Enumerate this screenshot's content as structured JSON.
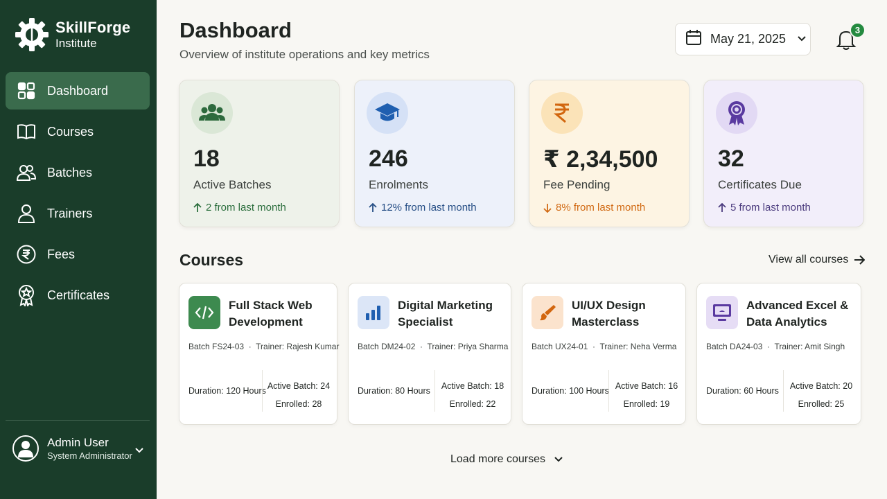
{
  "brand": {
    "name": "SkillForge",
    "subtitle": "Institute"
  },
  "sidebar": {
    "items": [
      {
        "label": "Dashboard",
        "icon": "grid-icon",
        "active": true
      },
      {
        "label": "Courses",
        "icon": "book-icon"
      },
      {
        "label": "Batches",
        "icon": "users-icon"
      },
      {
        "label": "Trainers",
        "icon": "user-icon"
      },
      {
        "label": "Fees",
        "icon": "rupee-icon"
      },
      {
        "label": "Certificates",
        "icon": "award-icon"
      }
    ],
    "user": {
      "name": "Admin User",
      "role": "System Administrator"
    }
  },
  "header": {
    "title": "Dashboard",
    "subtitle": "Overview of institute operations and key metrics",
    "date": "May 21, 2025",
    "notifications": "3"
  },
  "stats": [
    {
      "value": "18",
      "label": "Active Batches",
      "trend": "2 from last month",
      "direction": "up",
      "trend_color": "#2b6e3d",
      "bg": "#eef2ea",
      "icon_bg": "#dae7d6",
      "icon": "users-icon"
    },
    {
      "value": "246",
      "label": "Enrolments",
      "trend": "12% from last month",
      "direction": "up",
      "trend_color": "#274f86",
      "bg": "#edf1fa",
      "icon_bg": "#d5e1f6",
      "icon": "graduation-cap-icon"
    },
    {
      "value": "₹ 2,34,500",
      "label": "Fee Pending",
      "trend": "8% from last month",
      "direction": "down",
      "trend_color": "#d16a14",
      "bg": "#fdf4e3",
      "icon_bg": "#fbe3b8",
      "icon": "rupee-icon"
    },
    {
      "value": "32",
      "label": "Certificates Due",
      "trend": "5 from last month",
      "direction": "up",
      "trend_color": "#4b3b7e",
      "bg": "#f2eefa",
      "icon_bg": "#e2d9f4",
      "icon": "medal-icon"
    }
  ],
  "courses_section": {
    "title": "Courses",
    "view_all": "View all courses",
    "load_more": "Load more courses"
  },
  "courses": [
    {
      "title": "Full Stack Web Development",
      "batch": "Batch FS24-03",
      "trainer": "Trainer: Rajesh Kumar",
      "duration": "Duration: 120 Hours",
      "active_batch": "Active Batch: 24",
      "enrolled": "Enrolled: 28",
      "icon": "code-icon",
      "icon_bg": "#3d8a4f"
    },
    {
      "title": "Digital Marketing Specialist",
      "batch": "Batch DM24-02",
      "trainer": "Trainer: Priya Sharma",
      "duration": "Duration: 80 Hours",
      "active_batch": "Active Batch: 18",
      "enrolled": "Enrolled: 22",
      "icon": "bar-chart-icon",
      "icon_bg": "#dce6f7"
    },
    {
      "title": "UI/UX Design Masterclass",
      "batch": "Batch UX24-01",
      "trainer": "Trainer: Neha Verma",
      "duration": "Duration: 100 Hours",
      "active_batch": "Active Batch: 16",
      "enrolled": "Enrolled: 19",
      "icon": "brush-icon",
      "icon_bg": "#fbe3cd"
    },
    {
      "title": "Advanced Excel & Data Analytics",
      "batch": "Batch DA24-03",
      "trainer": "Trainer: Amit Singh",
      "duration": "Duration: 60 Hours",
      "active_batch": "Active Batch: 20",
      "enrolled": "Enrolled: 25",
      "icon": "monitor-icon",
      "icon_bg": "#e6ddf5"
    }
  ]
}
